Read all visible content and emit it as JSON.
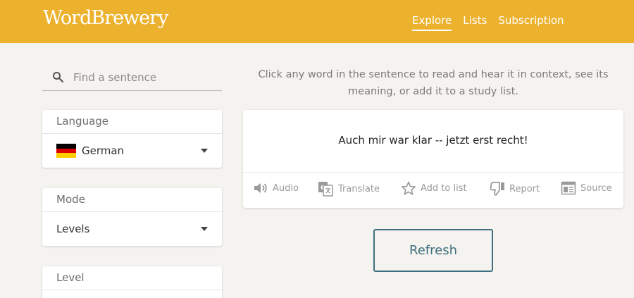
{
  "app": {
    "logo": "WordBrewery"
  },
  "nav": {
    "items": [
      {
        "label": "Explore",
        "active": true
      },
      {
        "label": "Lists",
        "active": false
      },
      {
        "label": "Subscription",
        "active": false
      }
    ]
  },
  "search": {
    "placeholder": "Find a sentence",
    "value": "",
    "icon": "search-icon"
  },
  "sidebar": {
    "language": {
      "title": "Language",
      "value": "German",
      "flag_colors": [
        "#000000",
        "#dd0000",
        "#ffce00"
      ]
    },
    "mode": {
      "title": "Mode",
      "value": "Levels"
    },
    "level": {
      "title": "Level"
    }
  },
  "main": {
    "instructions": "Click any word in the sentence to read and hear it in context, see its meaning, or add it to a study list.",
    "sentence": "Auch mir war klar -- jetzt erst recht!",
    "actions": [
      {
        "label": "Audio",
        "icon": "speaker-icon"
      },
      {
        "label": "Translate",
        "icon": "translate-icon"
      },
      {
        "label": "Add to list",
        "icon": "star-icon"
      },
      {
        "label": "Report",
        "icon": "thumbs-down-icon"
      },
      {
        "label": "Source",
        "icon": "source-icon"
      }
    ],
    "refresh_label": "Refresh"
  },
  "colors": {
    "header": "#ecb22e",
    "accent": "#3f6f7e",
    "background": "#f5f3ef"
  }
}
